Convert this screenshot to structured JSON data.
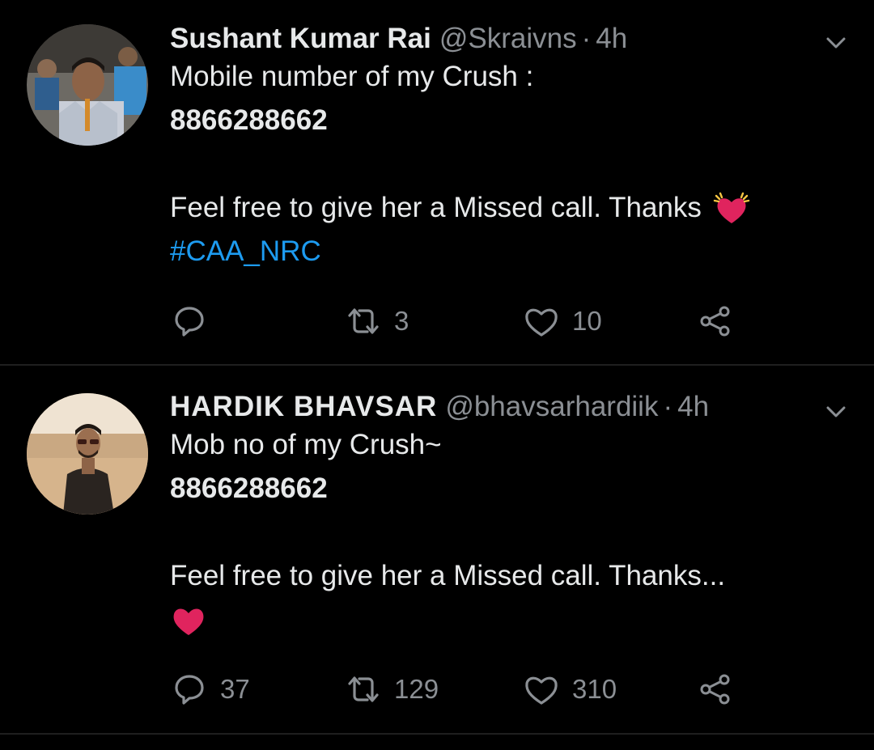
{
  "tweets": [
    {
      "display_name": "Sushant Kumar Rai",
      "handle": "@Skraivns",
      "separator": "·",
      "time": "4h",
      "line1": "Mobile number of my Crush :",
      "line2": "8866288662",
      "line3": "Feel free to give her a Missed call. Thanks",
      "hashtag": "#CAA_NRC",
      "emoji": "beating-heart-emoji",
      "replies": "",
      "retweets": "3",
      "likes": "10"
    },
    {
      "display_name": "HARDIK BHAVSAR",
      "handle": "@bhavsarhardiik",
      "separator": "·",
      "time": "4h",
      "line1": "Mob no of my Crush~",
      "line2": "8866288662",
      "line3": "Feel free to give her a Missed call. Thanks...",
      "emoji": "red-heart-emoji",
      "replies": "37",
      "retweets": "129",
      "likes": "310"
    }
  ],
  "icons": {
    "reply": "reply-icon",
    "retweet": "retweet-icon",
    "like": "like-icon",
    "share": "share-icon",
    "caret": "chevron-down-icon"
  },
  "colors": {
    "background": "#000000",
    "text": "#e7e9ea",
    "secondary": "#8b8f94",
    "link": "#1d9bf0",
    "divider": "#1f1f1f",
    "heart": "#e0245e"
  }
}
